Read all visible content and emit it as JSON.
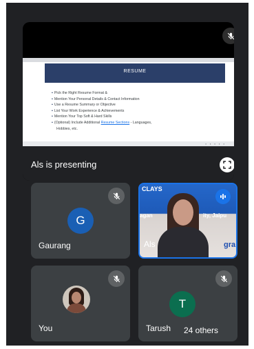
{
  "presentation": {
    "slide_title": "RESUME",
    "bullets": [
      "Pick the Right Resume Format &",
      "Mention Your Personal Details & Contact Information",
      "Use a Resume Summary or Objective",
      "List Your Work Experience & Achievements",
      "Mention Your Top Soft & Hard Skills"
    ],
    "optional_prefix": "(Optional) Include Additional ",
    "optional_link": "Resume Sections",
    "optional_suffix": " - Languages,",
    "optional_cont": "Hobbies, etc.",
    "presenter_label": "Als is presenting",
    "mic_icon": "mic-off-icon",
    "fullscreen_icon": "fullscreen-icon"
  },
  "participants": {
    "gaurang": {
      "initial": "G",
      "name": "Gaurang",
      "avatar_color": "#1a5fb4"
    },
    "als": {
      "name": "Als",
      "banner_top": "CLAYS",
      "banner_mid_left": "agan",
      "banner_mid_right": "ity, Jaipu",
      "banner_bottom": "gra",
      "speaking_icon": "audio-wave-icon"
    },
    "you": {
      "name": "You"
    },
    "tarushi": {
      "initial": "T",
      "name": "Tarush",
      "avatar_color": "#0b6e4f"
    }
  },
  "others": {
    "label": "24 others"
  },
  "colors": {
    "background": "#202124",
    "tile": "#3c4043",
    "accent": "#1a73e8"
  }
}
